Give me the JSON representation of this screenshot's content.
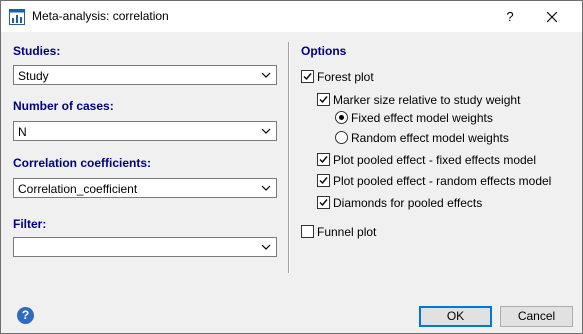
{
  "window": {
    "title": "Meta-analysis: correlation",
    "help_glyph": "?",
    "close_glyph": "✕"
  },
  "left": {
    "studies": {
      "label": "Studies:",
      "value": "Study"
    },
    "cases": {
      "label": "Number of cases:",
      "value": "N"
    },
    "correlation": {
      "label": "Correlation coefficients:",
      "value": "Correlation_coefficient"
    },
    "filter": {
      "label": "Filter:",
      "value": ""
    }
  },
  "options": {
    "title": "Options",
    "forest_plot": {
      "label": "Forest plot",
      "checked": true
    },
    "marker_size": {
      "label": "Marker size relative to study weight",
      "checked": true
    },
    "fixed_weights": {
      "label": "Fixed effect model weights",
      "selected": true
    },
    "random_weights": {
      "label": "Random effect model weights",
      "selected": false
    },
    "pooled_fixed": {
      "label": "Plot pooled effect - fixed effects model",
      "checked": true
    },
    "pooled_random": {
      "label": "Plot pooled effect - random effects model",
      "checked": true
    },
    "diamonds": {
      "label": "Diamonds for pooled effects",
      "checked": true
    },
    "funnel_plot": {
      "label": "Funnel plot",
      "checked": false
    }
  },
  "footer": {
    "help_icon_glyph": "?",
    "ok_label": "OK",
    "cancel_label": "Cancel"
  }
}
